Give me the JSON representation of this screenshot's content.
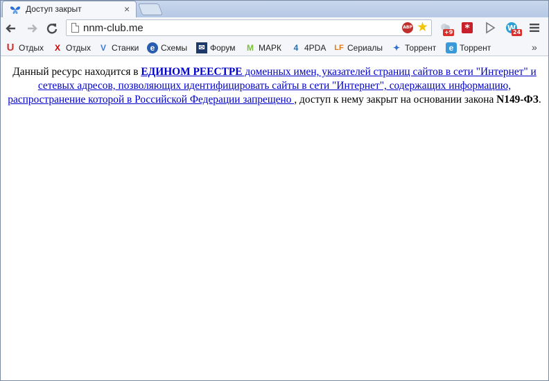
{
  "tab": {
    "title": "Доступ закрыт",
    "close": "×"
  },
  "toolbar": {
    "back": "←",
    "forward": "→",
    "reload": "↻",
    "url": "nnm-club.me",
    "abp_label": "ABP",
    "bookmark_star": "☆",
    "menu": "≡",
    "ext_badges": [
      "+9",
      "24"
    ]
  },
  "bookmarks": [
    {
      "icon": "u-icon",
      "glyph": "U",
      "color": "#d32f2f",
      "label": "Отдых"
    },
    {
      "icon": "x-icon",
      "glyph": "X",
      "color": "#cc0000",
      "label": "Отдых"
    },
    {
      "icon": "v-icon",
      "glyph": "V",
      "color": "#3b7bd6",
      "label": "Станки"
    },
    {
      "icon": "e-icon",
      "glyph": "e",
      "color": "#2a5db0",
      "label": "Схемы"
    },
    {
      "icon": "envelope-icon",
      "glyph": "✉",
      "color": "#1e3a6b",
      "label": "Форум"
    },
    {
      "icon": "mark-icon",
      "glyph": "M",
      "color": "#7bbf3a",
      "label": "МАРК"
    },
    {
      "icon": "4pda-icon",
      "glyph": "4",
      "color": "#2a6db0",
      "label": "4PDA"
    },
    {
      "icon": "lf-icon",
      "glyph": "LF",
      "color": "#e07b1a",
      "label": "Сериалы"
    },
    {
      "icon": "butterfly-icon",
      "glyph": "✦",
      "color": "#2f6fcf",
      "label": "Торрент"
    },
    {
      "icon": "e-blue-icon",
      "glyph": "e",
      "color": "#3a9ad9",
      "label": "Торрент"
    }
  ],
  "more_bookmarks": "»",
  "message": {
    "prefix": "Данный ресурс находится в ",
    "registry_bold": "ЕДИНОМ РЕЕСТРЕ",
    "registry_rest": " доменных имен, указателей страниц сайтов в сети \"Интернет\" и сетевых адресов, позволяющих идентифицировать сайты в сети \"Интернет\", содержащих информацию, распространение которой в Российской Федерации запрещено ",
    "suffix": ", доступ к нему закрыт на основании закона ",
    "law": "N149-ФЗ",
    "end": "."
  },
  "colors": {
    "link": "#0000cc",
    "tabstrip": "#c2d3ea"
  }
}
